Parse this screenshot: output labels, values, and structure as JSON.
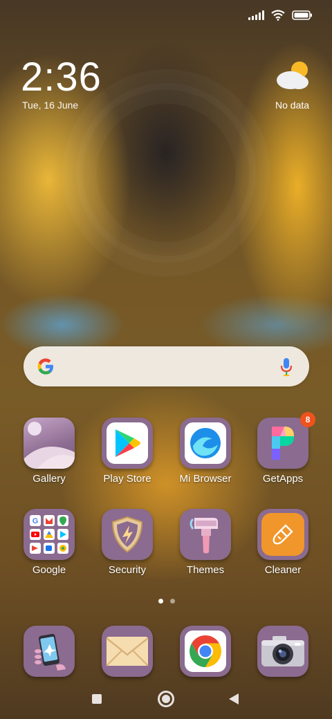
{
  "status": {
    "icons": [
      "signal-icon",
      "wifi-icon",
      "battery-icon"
    ]
  },
  "clock": {
    "time": "2:36",
    "date": "Tue, 16 June"
  },
  "weather": {
    "text": "No data",
    "icon": "partly-cloudy-icon"
  },
  "search": {
    "logo": "google-g-icon",
    "voice": "mic-icon"
  },
  "apps_row1": [
    {
      "label": "Gallery"
    },
    {
      "label": "Play Store"
    },
    {
      "label": "Mi Browser"
    },
    {
      "label": "GetApps",
      "badge": "8"
    }
  ],
  "apps_row2": [
    {
      "label": "Google"
    },
    {
      "label": "Security"
    },
    {
      "label": "Themes"
    },
    {
      "label": "Cleaner"
    }
  ],
  "dock": [
    {
      "icon": "phone-icon"
    },
    {
      "icon": "messages-icon"
    },
    {
      "icon": "chrome-icon"
    },
    {
      "icon": "camera-icon"
    }
  ],
  "pages": {
    "count": 2,
    "current": 1
  },
  "colors": {
    "tile": "#8b6b8f",
    "badge": "#f0521c",
    "cleaner": "#f0962a"
  }
}
